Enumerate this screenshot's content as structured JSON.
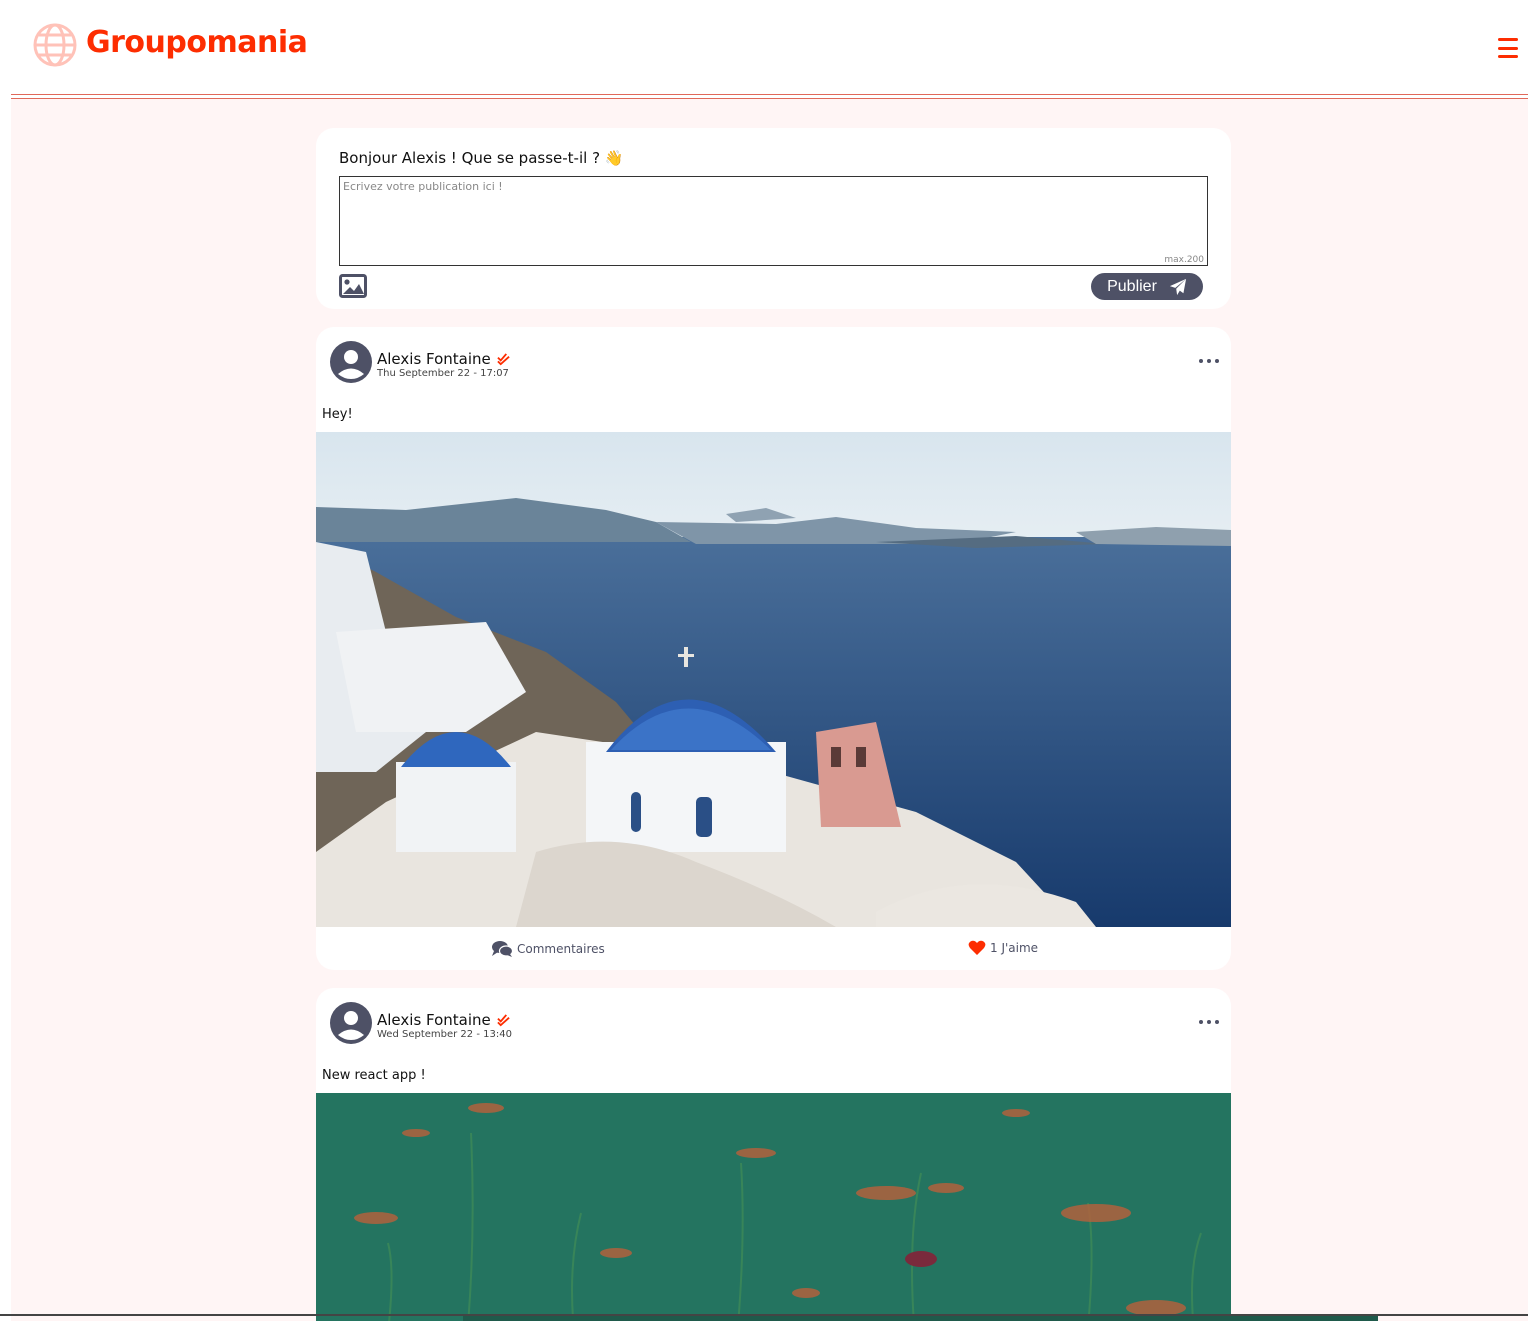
{
  "header": {
    "brand_name": "Groupomania",
    "logo_icon": "globe-icon",
    "menu_icon": "hamburger-icon",
    "accent_color": "#fd2d01"
  },
  "composer": {
    "greeting": "Bonjour Alexis ! Que se passe-t-il ? 👋",
    "textarea_placeholder": "Ecrivez votre publication ici !",
    "textarea_value": "",
    "max_length_hint": "max.200",
    "image_button_icon": "image-icon",
    "publish_label": "Publier",
    "publish_icon": "paper-plane-icon",
    "button_color": "#4e5166"
  },
  "posts": [
    {
      "author": "Alexis Fontaine",
      "date": "Thu September 22 - 17:07",
      "text": "Hey!",
      "image": "santorini-blue-domes-sea",
      "comments_label": "Commentaires",
      "likes_label": "1 J'aime"
    },
    {
      "author": "Alexis Fontaine",
      "date": "Wed September 22 - 13:40",
      "text": "New react app !",
      "image": "green-pond-water-plants"
    }
  ]
}
